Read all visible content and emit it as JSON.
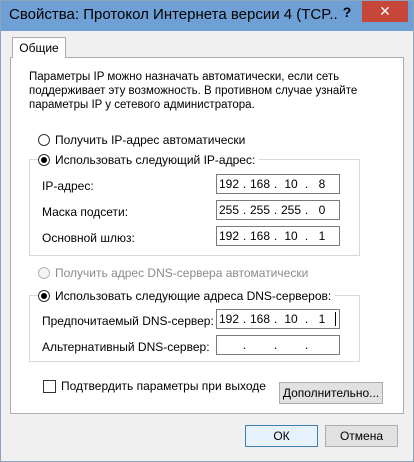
{
  "window": {
    "title": "Свойства: Протокол Интернета версии 4 (TCP...",
    "help_label": "?",
    "close_label": "✕"
  },
  "tabs": [
    {
      "label": "Общие",
      "selected": true
    }
  ],
  "description": "Параметры IP можно назначать автоматически, если сеть поддерживает эту возможность. В противном случае узнайте параметры IP у сетевого администратора.",
  "ip_mode": {
    "auto_label": "Получить IP-адрес автоматически",
    "manual_label": "Использовать следующий IP-адрес:",
    "selected": "manual"
  },
  "ip_fields": {
    "ip": {
      "label": "IP-адрес:",
      "octets": [
        "192",
        "168",
        "10",
        "8"
      ]
    },
    "mask": {
      "label": "Маска подсети:",
      "octets": [
        "255",
        "255",
        "255",
        "0"
      ]
    },
    "gateway": {
      "label": "Основной шлюз:",
      "octets": [
        "192",
        "168",
        "10",
        "1"
      ]
    }
  },
  "dns_mode": {
    "auto_label": "Получить адрес DNS-сервера автоматически",
    "auto_disabled": true,
    "manual_label": "Использовать следующие адреса DNS-серверов:",
    "selected": "manual"
  },
  "dns_fields": {
    "preferred": {
      "label": "Предпочитаемый DNS-сервер:",
      "octets": [
        "192",
        "168",
        "10",
        "1"
      ]
    },
    "alternate": {
      "label": "Альтернативный DNS-сервер:",
      "octets": [
        "",
        "",
        "",
        ""
      ]
    }
  },
  "validate_on_exit": {
    "label": "Подтвердить параметры при выходе",
    "checked": false
  },
  "buttons": {
    "advanced": "Дополнительно...",
    "ok": "ОК",
    "cancel": "Отмена"
  }
}
